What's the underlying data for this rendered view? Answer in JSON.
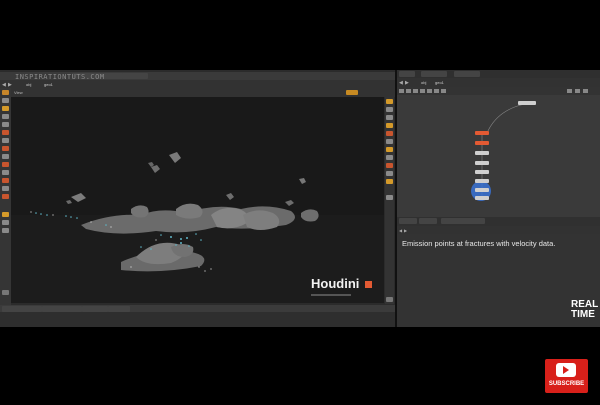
{
  "watermark": "INSPIRATIONTUTS.COM",
  "viewer": {
    "toolbar_tabs": [
      "",
      "",
      "",
      ""
    ],
    "path": "obj",
    "node": "geo1",
    "pane_label": "View"
  },
  "network": {
    "path": "obj",
    "node": "geo1",
    "nodes": [
      {
        "label": "",
        "color": "#cfcfcf"
      },
      {
        "label": "",
        "color": "#e35a33"
      },
      {
        "label": "",
        "color": "#e35a33"
      },
      {
        "label": "",
        "color": "#cfcfcf"
      },
      {
        "label": "",
        "color": "#cfcfcf"
      },
      {
        "label": "",
        "color": "#cfcfcf"
      },
      {
        "label": "",
        "color": "#cfcfcf"
      },
      {
        "label": "",
        "color": "#cfcfcf"
      },
      {
        "label": "",
        "color": "#cfcfcf"
      }
    ]
  },
  "sticky_note": "Emission points at fractures with velocity data.",
  "brand": {
    "houdini": "Houdini",
    "realtime_line1": "REAL",
    "realtime_line2": "TIME"
  },
  "subscribe": "SUBSCRIBE",
  "colors": {
    "accent_orange": "#e35a33",
    "subscribe_red": "#d8201a",
    "highlight_blue": "#3a73d6"
  }
}
